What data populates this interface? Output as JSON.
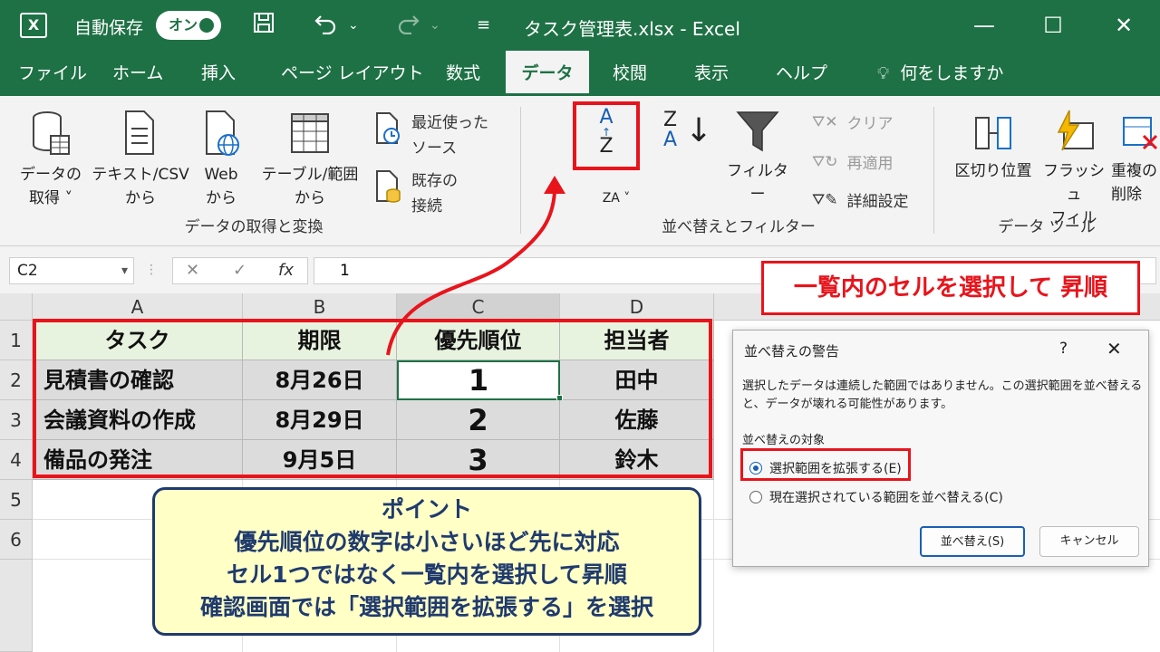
{
  "titlebar": {
    "app_logo": "X",
    "autosave_label": "自動保存",
    "autosave_state": "オン",
    "document_title": "タスク管理表.xlsx  -  Excel",
    "save_icon": "save-icon",
    "undo_icon": "undo-icon",
    "redo_icon": "redo-icon"
  },
  "menu": {
    "tabs": [
      "ファイル",
      "ホーム",
      "挿入",
      "ページ レイアウト",
      "数式",
      "データ",
      "校閲",
      "表示",
      "ヘルプ",
      "何をしますか"
    ],
    "active": "データ"
  },
  "ribbon": {
    "get_data": {
      "items": [
        {
          "label1": "データの",
          "label2": "取得 ˅"
        },
        {
          "label1": "テキスト/CSV",
          "label2": "から"
        },
        {
          "label1": "Web",
          "label2": "から"
        },
        {
          "label1": "テーブル/範囲",
          "label2": "から"
        }
      ],
      "recent_sources_1": "最近使った",
      "recent_sources_2": "ソース",
      "existing_conn_1": "既存の",
      "existing_conn_2": "接続",
      "group_label": "データの取得と変換"
    },
    "sort_filter": {
      "sort_az_top": "A",
      "sort_az_bottom": "Z",
      "sort_za_top": "Z",
      "sort_za_bottom": "A",
      "sort_label": "ZA ˅",
      "filter_label": "フィルター",
      "clear_label": "クリア",
      "reapply_label": "再適用",
      "advanced_label": "詳細設定",
      "group_label": "並べ替えとフィルター"
    },
    "data_tools": {
      "text_to_columns": "区切り位置",
      "flash_fill_1": "フラッシュ",
      "flash_fill_2": "フィル",
      "remove_dup_1": "重複の",
      "remove_dup_2": "削除",
      "group_label": "データ ツール"
    }
  },
  "formula_bar": {
    "name_box": "C2",
    "cancel": "✕",
    "enter": "✓",
    "fx": "fx",
    "value": "1"
  },
  "sheet": {
    "columns": [
      "A",
      "B",
      "C",
      "D"
    ],
    "rows": [
      "1",
      "2",
      "3",
      "4",
      "5",
      "6"
    ],
    "header": [
      "タスク",
      "期限",
      "優先順位",
      "担当者"
    ],
    "data": [
      [
        "見積書の確認",
        "8月26日",
        "1",
        "田中"
      ],
      [
        "会議資料の作成",
        "8月29日",
        "2",
        "佐藤"
      ],
      [
        "備品の発注",
        "9月5日",
        "3",
        "鈴木"
      ]
    ]
  },
  "annotations": {
    "sort_callout": "一覧内のセルを選択して 昇順",
    "point_title": "ポイント",
    "point_lines": [
      "優先順位の数字は小さいほど先に対応",
      "セル1つではなく一覧内を選択して昇順",
      "確認画面では「選択範囲を拡張する」を選択"
    ],
    "accent_red": "#e8141c"
  },
  "dialog": {
    "title": "並べ替えの警告",
    "help": "?",
    "close": "✕",
    "message": "選択したデータは連続した範囲ではありません。この選択範囲を並べ替えると、データが壊れる可能性があります。",
    "group_label": "並べ替えの対象",
    "option_expand": "選択範囲を拡張する(E)",
    "option_current": "現在選択されている範囲を並べ替える(C)",
    "sort_button": "並べ替え(S)",
    "cancel_button": "キャンセル"
  },
  "colors": {
    "excel_green": "#1e7145",
    "dialog_blue": "#1a5fb4"
  }
}
